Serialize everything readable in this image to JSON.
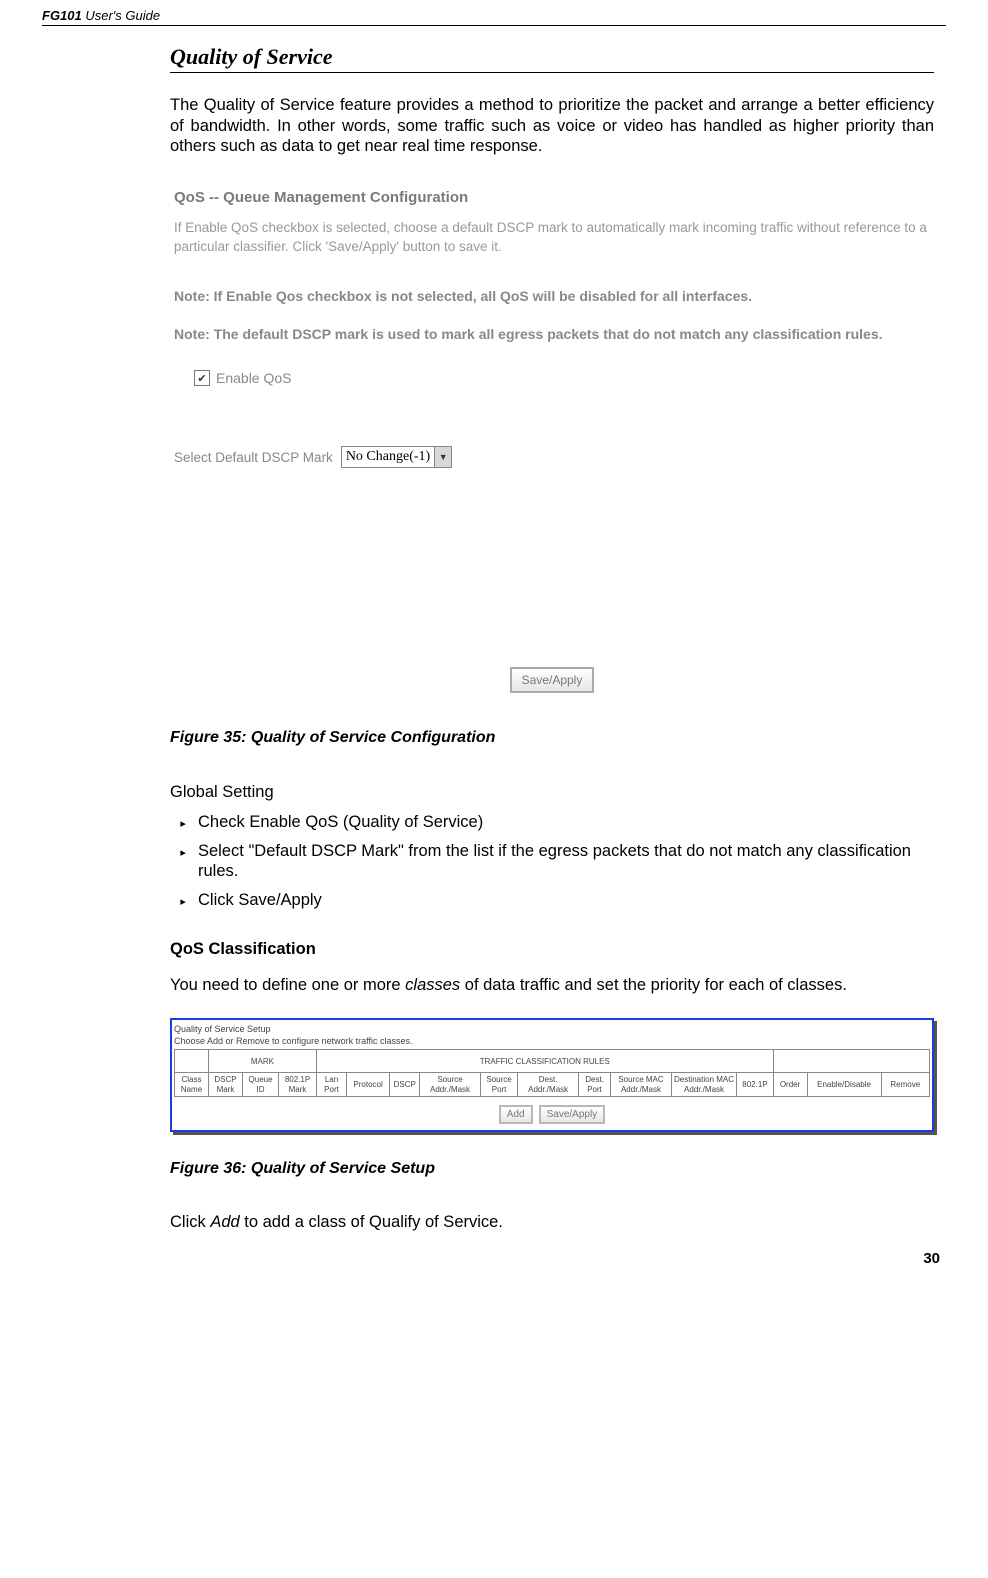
{
  "header": {
    "product": "FG101",
    "guide": " User's Guide"
  },
  "section_title": "Quality of Service",
  "intro_para": "The Quality of Service feature provides a method to prioritize the packet and arrange a better efficiency of bandwidth. In other words, some traffic such as voice or video has handled as higher priority than others such as data to get near real time response.",
  "screenshot1": {
    "title": "QoS -- Queue Management Configuration",
    "desc": "If Enable QoS checkbox is selected, choose a default DSCP mark to automatically mark incoming traffic without reference to a particular classifier. Click 'Save/Apply' button to save it.",
    "note1": "Note: If Enable Qos checkbox is not selected, all QoS will be disabled for all interfaces.",
    "note2": "Note: The default DSCP mark is used to mark all egress packets that do not match any classification rules.",
    "checkbox_label": "Enable QoS",
    "select_label": "Select Default DSCP Mark",
    "select_value": "No Change(-1)",
    "button": "Save/Apply"
  },
  "fig35_caption": "Figure 35: Quality of Service Configuration",
  "global_setting_label": "Global Setting",
  "bullets": {
    "b1": "Check Enable QoS (Quality of Service)",
    "b2": "Select \"Default DSCP Mark\" from the list if the egress packets that do not match any classification rules.",
    "b3": "Click Save/Apply"
  },
  "qos_class_heading": "QoS Classification",
  "qos_class_para_pre": "You need to define one or more ",
  "qos_class_para_em": "classes",
  "qos_class_para_post": " of data traffic and set the priority for each of classes.",
  "screenshot2": {
    "title1": "Quality of Service Setup",
    "title2": "Choose Add or Remove to configure network traffic classes.",
    "group_mark": "MARK",
    "group_rules": "TRAFFIC CLASSIFICATION RULES",
    "cols": {
      "c1": "Class Name",
      "c2": "DSCP Mark",
      "c3": "Queue ID",
      "c4": "802.1P Mark",
      "c5": "Lan Port",
      "c6": "Protocol",
      "c7": "DSCP",
      "c8": "Source Addr./Mask",
      "c9": "Source Port",
      "c10": "Dest. Addr./Mask",
      "c11": "Dest. Port",
      "c12": "Source MAC Addr./Mask",
      "c13": "Destination MAC Addr./Mask",
      "c14": "802.1P",
      "c15": "Order",
      "c16": "Enable/Disable",
      "c17": "Remove"
    },
    "btn_add": "Add",
    "btn_save": "Save/Apply"
  },
  "fig36_caption": "Figure 36: Quality of Service Setup",
  "click_add_pre": "Click ",
  "click_add_em": "Add",
  "click_add_post": " to add a class of Qualify of Service.",
  "page_number": "30"
}
